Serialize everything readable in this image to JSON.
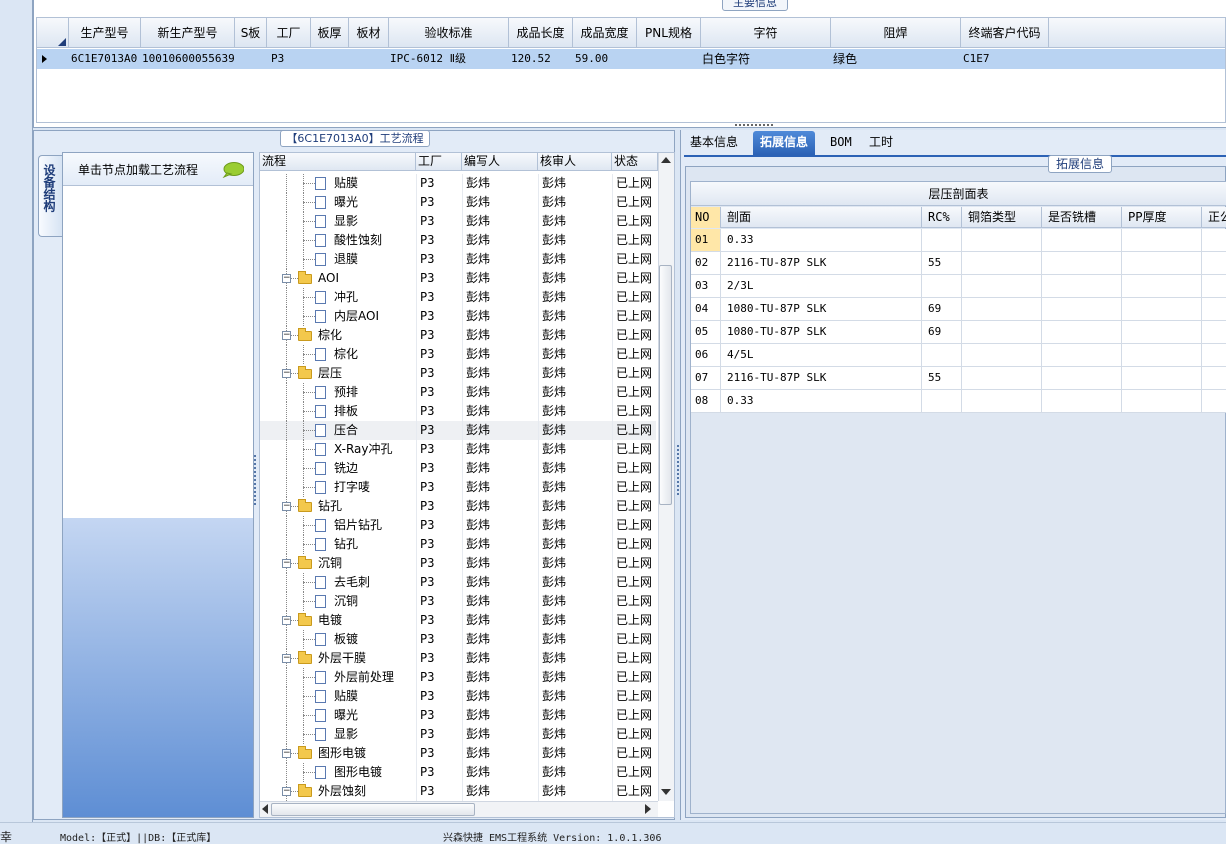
{
  "top": {
    "title": "主要信息",
    "columns": [
      "生产型号",
      "新生产型号",
      "S板",
      "工厂",
      "板厚",
      "板材",
      "验收标准",
      "成品长度",
      "成品宽度",
      "PNL规格",
      "字符",
      "阻焊",
      "终端客户代码"
    ],
    "row": {
      "prod_model": "6C1E7013A0",
      "new_model": "10010600055639",
      "factory": "P3",
      "standard": "IPC-6012 Ⅱ级",
      "length": "120.52",
      "width": "59.00",
      "char": "白色字符",
      "mask": "绿色",
      "customer_code": "C1E7"
    }
  },
  "left": {
    "panel_title": "【6C1E7013A0】工艺流程",
    "side_tab": "设备结构",
    "flow_hint": "单击节点加载工艺流程",
    "tree_columns": [
      "流程",
      "工厂",
      "编写人",
      "核审人",
      "状态"
    ],
    "rows": [
      {
        "name": "贴膜",
        "level": 2,
        "factory": "P3",
        "writer": "彭炜",
        "reviewer": "彭炜",
        "status": "已上网"
      },
      {
        "name": "曝光",
        "level": 2,
        "factory": "P3",
        "writer": "彭炜",
        "reviewer": "彭炜",
        "status": "已上网"
      },
      {
        "name": "显影",
        "level": 2,
        "factory": "P3",
        "writer": "彭炜",
        "reviewer": "彭炜",
        "status": "已上网"
      },
      {
        "name": "酸性蚀刻",
        "level": 2,
        "factory": "P3",
        "writer": "彭炜",
        "reviewer": "彭炜",
        "status": "已上网"
      },
      {
        "name": "退膜",
        "level": 2,
        "factory": "P3",
        "writer": "彭炜",
        "reviewer": "彭炜",
        "status": "已上网"
      },
      {
        "name": "AOI",
        "level": 1,
        "factory": "P3",
        "writer": "彭炜",
        "reviewer": "彭炜",
        "status": "已上网"
      },
      {
        "name": "冲孔",
        "level": 2,
        "factory": "P3",
        "writer": "彭炜",
        "reviewer": "彭炜",
        "status": "已上网"
      },
      {
        "name": "内层AOI",
        "level": 2,
        "factory": "P3",
        "writer": "彭炜",
        "reviewer": "彭炜",
        "status": "已上网"
      },
      {
        "name": "棕化",
        "level": 1,
        "factory": "P3",
        "writer": "彭炜",
        "reviewer": "彭炜",
        "status": "已上网"
      },
      {
        "name": "棕化",
        "level": 2,
        "factory": "P3",
        "writer": "彭炜",
        "reviewer": "彭炜",
        "status": "已上网"
      },
      {
        "name": "层压",
        "level": 1,
        "factory": "P3",
        "writer": "彭炜",
        "reviewer": "彭炜",
        "status": "已上网"
      },
      {
        "name": "预排",
        "level": 2,
        "factory": "P3",
        "writer": "彭炜",
        "reviewer": "彭炜",
        "status": "已上网"
      },
      {
        "name": "排板",
        "level": 2,
        "factory": "P3",
        "writer": "彭炜",
        "reviewer": "彭炜",
        "status": "已上网"
      },
      {
        "name": "压合",
        "level": 2,
        "factory": "P3",
        "writer": "彭炜",
        "reviewer": "彭炜",
        "status": "已上网"
      },
      {
        "name": "X-Ray冲孔",
        "level": 2,
        "factory": "P3",
        "writer": "彭炜",
        "reviewer": "彭炜",
        "status": "已上网"
      },
      {
        "name": "铣边",
        "level": 2,
        "factory": "P3",
        "writer": "彭炜",
        "reviewer": "彭炜",
        "status": "已上网"
      },
      {
        "name": "打字唛",
        "level": 2,
        "factory": "P3",
        "writer": "彭炜",
        "reviewer": "彭炜",
        "status": "已上网"
      },
      {
        "name": "钻孔",
        "level": 1,
        "factory": "P3",
        "writer": "彭炜",
        "reviewer": "彭炜",
        "status": "已上网"
      },
      {
        "name": "铝片钻孔",
        "level": 2,
        "factory": "P3",
        "writer": "彭炜",
        "reviewer": "彭炜",
        "status": "已上网"
      },
      {
        "name": "钻孔",
        "level": 2,
        "factory": "P3",
        "writer": "彭炜",
        "reviewer": "彭炜",
        "status": "已上网"
      },
      {
        "name": "沉铜",
        "level": 1,
        "factory": "P3",
        "writer": "彭炜",
        "reviewer": "彭炜",
        "status": "已上网"
      },
      {
        "name": "去毛刺",
        "level": 2,
        "factory": "P3",
        "writer": "彭炜",
        "reviewer": "彭炜",
        "status": "已上网"
      },
      {
        "name": "沉铜",
        "level": 2,
        "factory": "P3",
        "writer": "彭炜",
        "reviewer": "彭炜",
        "status": "已上网"
      },
      {
        "name": "电镀",
        "level": 1,
        "factory": "P3",
        "writer": "彭炜",
        "reviewer": "彭炜",
        "status": "已上网"
      },
      {
        "name": "板镀",
        "level": 2,
        "factory": "P3",
        "writer": "彭炜",
        "reviewer": "彭炜",
        "status": "已上网"
      },
      {
        "name": "外层干膜",
        "level": 1,
        "factory": "P3",
        "writer": "彭炜",
        "reviewer": "彭炜",
        "status": "已上网"
      },
      {
        "name": "外层前处理",
        "level": 2,
        "factory": "P3",
        "writer": "彭炜",
        "reviewer": "彭炜",
        "status": "已上网"
      },
      {
        "name": "贴膜",
        "level": 2,
        "factory": "P3",
        "writer": "彭炜",
        "reviewer": "彭炜",
        "status": "已上网"
      },
      {
        "name": "曝光",
        "level": 2,
        "factory": "P3",
        "writer": "彭炜",
        "reviewer": "彭炜",
        "status": "已上网"
      },
      {
        "name": "显影",
        "level": 2,
        "factory": "P3",
        "writer": "彭炜",
        "reviewer": "彭炜",
        "status": "已上网"
      },
      {
        "name": "图形电镀",
        "level": 1,
        "factory": "P3",
        "writer": "彭炜",
        "reviewer": "彭炜",
        "status": "已上网"
      },
      {
        "name": "图形电镀",
        "level": 2,
        "factory": "P3",
        "writer": "彭炜",
        "reviewer": "彭炜",
        "status": "已上网"
      },
      {
        "name": "外层蚀刻",
        "level": 1,
        "factory": "P3",
        "writer": "彭炜",
        "reviewer": "彭炜",
        "status": "已上网"
      }
    ],
    "selected_row": "压合"
  },
  "right": {
    "tabs": [
      "基本信息",
      "拓展信息",
      "BOM",
      "工时"
    ],
    "active_tab": "拓展信息",
    "group_title": "拓展信息",
    "table_title": "层压剖面表",
    "columns": [
      "NO",
      "剖面",
      "RC%",
      "铜箔类型",
      "是否铣槽",
      "PP厚度",
      "正公差"
    ],
    "rows": [
      {
        "no": "01",
        "section": "0.33",
        "rc": ""
      },
      {
        "no": "02",
        "section": "2116-TU-87P SLK",
        "rc": "55"
      },
      {
        "no": "03",
        "section": "2/3L",
        "rc": ""
      },
      {
        "no": "04",
        "section": "1080-TU-87P SLK",
        "rc": "69"
      },
      {
        "no": "05",
        "section": "1080-TU-87P SLK",
        "rc": "69"
      },
      {
        "no": "06",
        "section": "4/5L",
        "rc": ""
      },
      {
        "no": "07",
        "section": "2116-TU-87P SLK",
        "rc": "55"
      },
      {
        "no": "08",
        "section": "0.33",
        "rc": ""
      }
    ]
  },
  "status": {
    "left_char": "幸",
    "model_db": "Model:【正式】||DB:【正式库】",
    "app": "兴森快捷 EMS工程系统 Version: 1.0.1.306"
  }
}
